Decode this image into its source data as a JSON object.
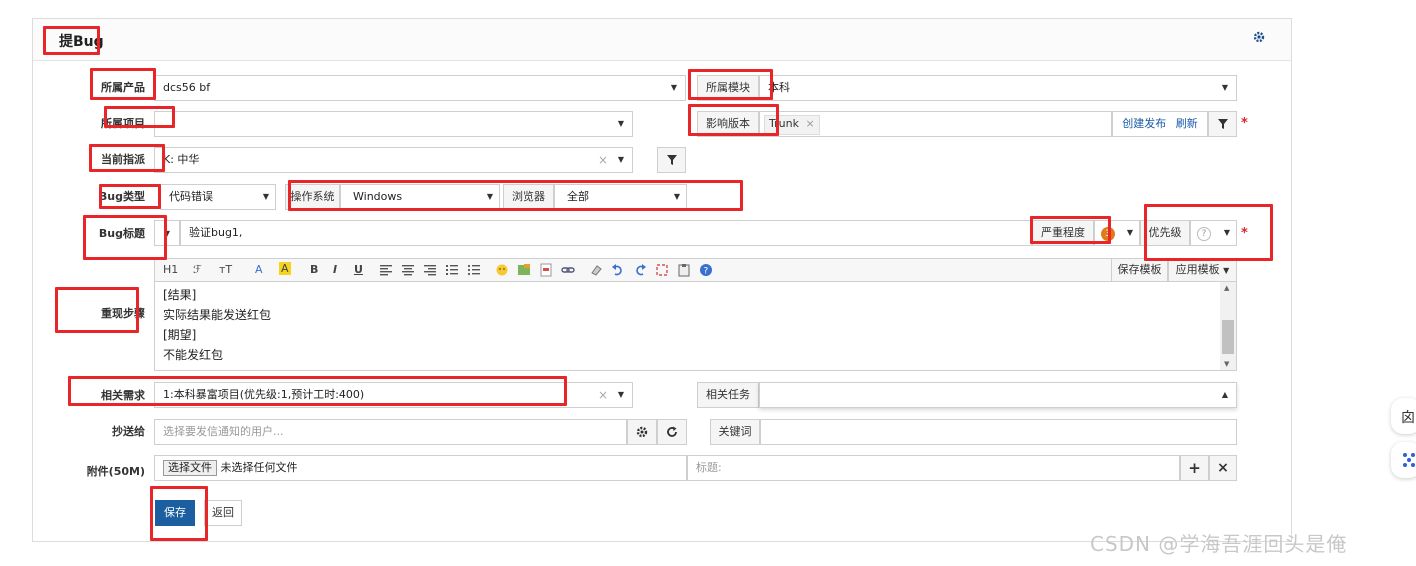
{
  "header": {
    "title": "提Bug",
    "settings_icon": "gear-icon"
  },
  "form": {
    "product": {
      "label": "所属产品",
      "value": "dcs56 bf"
    },
    "module": {
      "label": "所属模块",
      "value": "本科"
    },
    "project": {
      "label": "所属项目",
      "value": ""
    },
    "build": {
      "label": "影响版本",
      "tag": "Trunk",
      "create_link": "创建发布",
      "refresh_link": "刷新"
    },
    "assign": {
      "label": "当前指派",
      "value": "K: 中华"
    },
    "bug_type": {
      "label": "Bug类型",
      "value": "代码错误"
    },
    "os": {
      "label": "操作系统",
      "value": "Windows"
    },
    "browser": {
      "label": "浏览器",
      "value": "全部"
    },
    "title": {
      "label": "Bug标题",
      "value": "验证bug1,"
    },
    "severity": {
      "label": "严重程度",
      "value": "3"
    },
    "priority": {
      "label": "优先级",
      "value": "?"
    },
    "steps": {
      "label": "重现步骤",
      "lines": [
        "[结果]",
        "实际结果能发送红包",
        "[期望]",
        "不能发红包"
      ],
      "toolbar": {
        "h1": "H1",
        "font": "ℱ",
        "size": "тT",
        "color": "A",
        "bg": "A",
        "bold": "B",
        "italic": "I",
        "underline": "U"
      },
      "save_template": "保存模板",
      "apply_template": "应用模板"
    },
    "story": {
      "label": "相关需求",
      "value": "1:本科暴富项目(优先级:1,预计工时:400)"
    },
    "task": {
      "label": "相关任务",
      "value": ""
    },
    "mailto": {
      "label": "抄送给",
      "placeholder": "选择要发信通知的用户..."
    },
    "keywords": {
      "label": "关键词",
      "value": ""
    },
    "files": {
      "label": "附件(50M)",
      "choose": "选择文件",
      "none": "未选择任何文件",
      "title_placeholder": "标题:"
    },
    "save": "保存",
    "back": "返回"
  },
  "watermark": "CSDN @学海吾涯回头是俺",
  "side": {
    "translate": "囟"
  },
  "colors": {
    "annotation": "#e8262a",
    "primary": "#1c5fa0",
    "link": "#1a5aa6"
  }
}
